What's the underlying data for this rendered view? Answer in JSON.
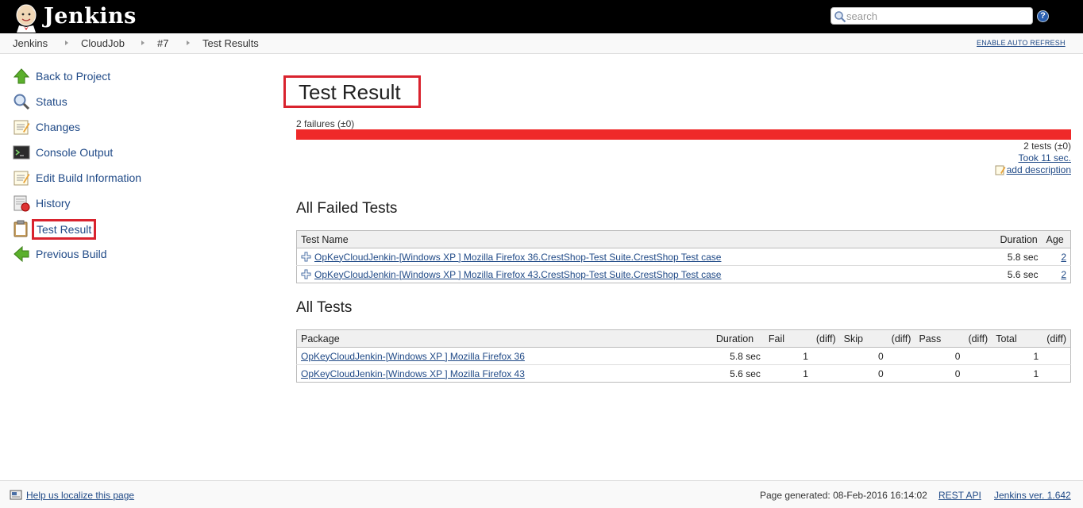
{
  "header": {
    "brand": "Jenkins",
    "search_placeholder": "search",
    "help_label": "?"
  },
  "breadcrumb": {
    "items": [
      "Jenkins",
      "CloudJob",
      "#7",
      "Test Results"
    ],
    "auto_refresh": "ENABLE AUTO REFRESH"
  },
  "sidebar": {
    "items": [
      {
        "label": "Back to Project",
        "icon": "up-arrow-icon"
      },
      {
        "label": "Status",
        "icon": "magnifier-icon"
      },
      {
        "label": "Changes",
        "icon": "notepad-icon"
      },
      {
        "label": "Console Output",
        "icon": "terminal-icon"
      },
      {
        "label": "Edit Build Information",
        "icon": "notepad-icon"
      },
      {
        "label": "History",
        "icon": "history-icon"
      },
      {
        "label": "Test Result",
        "icon": "clipboard-icon"
      },
      {
        "label": "Previous Build",
        "icon": "left-arrow-icon"
      }
    ]
  },
  "main": {
    "title": "Test Result",
    "failures": "2 failures (±0)",
    "fail_fraction": 1.0,
    "tests_count": "2 tests (±0)",
    "took": "Took 11 sec.",
    "add_description": "add description",
    "failed_section": {
      "title": "All Failed Tests",
      "headers": [
        "Test Name",
        "Duration",
        "Age"
      ],
      "rows": [
        {
          "name": "OpKeyCloudJenkin-[Windows XP ] Mozilla Firefox 36.CrestShop-Test Suite.CrestShop Test case",
          "duration": "5.8 sec",
          "age": "2"
        },
        {
          "name": "OpKeyCloudJenkin-[Windows XP ] Mozilla Firefox 43.CrestShop-Test Suite.CrestShop Test case",
          "duration": "5.6 sec",
          "age": "2"
        }
      ]
    },
    "all_section": {
      "title": "All Tests",
      "headers": [
        "Package",
        "Duration",
        "Fail",
        "(diff)",
        "Skip",
        "(diff)",
        "Pass",
        "(diff)",
        "Total",
        "(diff)"
      ],
      "rows": [
        {
          "package": "OpKeyCloudJenkin-[Windows XP ] Mozilla Firefox 36",
          "duration": "5.8 sec",
          "fail": "1",
          "skip": "0",
          "pass": "0",
          "total": "1"
        },
        {
          "package": "OpKeyCloudJenkin-[Windows XP ] Mozilla Firefox 43",
          "duration": "5.6 sec",
          "fail": "1",
          "skip": "0",
          "pass": "0",
          "total": "1"
        }
      ]
    }
  },
  "footer": {
    "localize": "Help us localize this page",
    "generated": "Page generated: 08-Feb-2016 16:14:02",
    "rest_api": "REST API",
    "version": "Jenkins ver. 1.642"
  },
  "colors": {
    "fail_bar": "#ef2929",
    "highlight_box": "#d9232e",
    "link": "#204a87"
  }
}
